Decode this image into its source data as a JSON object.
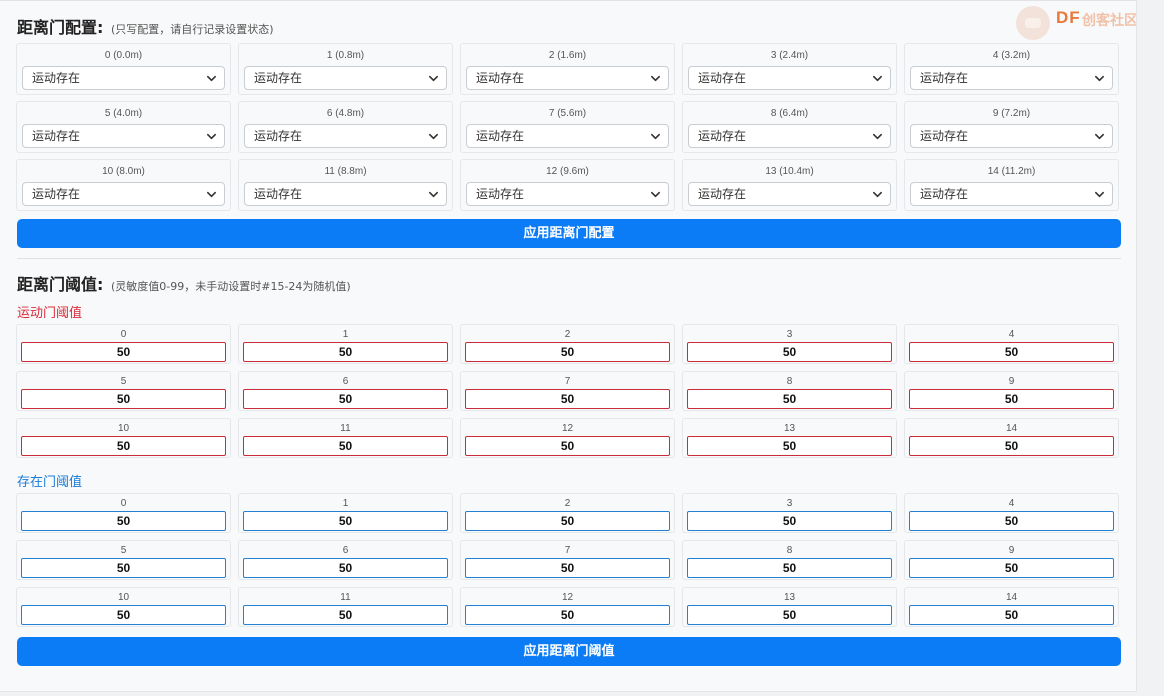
{
  "logo": {
    "brand": "DF",
    "text": "创客社区",
    "icon": "robot-logo-icon"
  },
  "gate_config": {
    "title": "距离门配置:",
    "hint": "(只写配置，请自行记录设置状态)",
    "gates": [
      {
        "label": "0 (0.0m)",
        "value": "运动存在"
      },
      {
        "label": "1 (0.8m)",
        "value": "运动存在"
      },
      {
        "label": "2 (1.6m)",
        "value": "运动存在"
      },
      {
        "label": "3 (2.4m)",
        "value": "运动存在"
      },
      {
        "label": "4 (3.2m)",
        "value": "运动存在"
      },
      {
        "label": "5 (4.0m)",
        "value": "运动存在"
      },
      {
        "label": "6 (4.8m)",
        "value": "运动存在"
      },
      {
        "label": "7 (5.6m)",
        "value": "运动存在"
      },
      {
        "label": "8 (6.4m)",
        "value": "运动存在"
      },
      {
        "label": "9 (7.2m)",
        "value": "运动存在"
      },
      {
        "label": "10 (8.0m)",
        "value": "运动存在"
      },
      {
        "label": "11 (8.8m)",
        "value": "运动存在"
      },
      {
        "label": "12 (9.6m)",
        "value": "运动存在"
      },
      {
        "label": "13 (10.4m)",
        "value": "运动存在"
      },
      {
        "label": "14 (11.2m)",
        "value": "运动存在"
      }
    ],
    "apply_label": "应用距离门配置"
  },
  "thresholds": {
    "title": "距离门阈值:",
    "hint": "(灵敏度值0-99，未手动设置时#15-24为随机值)",
    "motion": {
      "title": "运动门阈值",
      "color": "#d92c3a",
      "items": [
        {
          "label": "0",
          "value": "50"
        },
        {
          "label": "1",
          "value": "50"
        },
        {
          "label": "2",
          "value": "50"
        },
        {
          "label": "3",
          "value": "50"
        },
        {
          "label": "4",
          "value": "50"
        },
        {
          "label": "5",
          "value": "50"
        },
        {
          "label": "6",
          "value": "50"
        },
        {
          "label": "7",
          "value": "50"
        },
        {
          "label": "8",
          "value": "50"
        },
        {
          "label": "9",
          "value": "50"
        },
        {
          "label": "10",
          "value": "50"
        },
        {
          "label": "11",
          "value": "50"
        },
        {
          "label": "12",
          "value": "50"
        },
        {
          "label": "13",
          "value": "50"
        },
        {
          "label": "14",
          "value": "50"
        }
      ]
    },
    "still": {
      "title": "存在门阈值",
      "color": "#1a7bd8",
      "items": [
        {
          "label": "0",
          "value": "50"
        },
        {
          "label": "1",
          "value": "50"
        },
        {
          "label": "2",
          "value": "50"
        },
        {
          "label": "3",
          "value": "50"
        },
        {
          "label": "4",
          "value": "50"
        },
        {
          "label": "5",
          "value": "50"
        },
        {
          "label": "6",
          "value": "50"
        },
        {
          "label": "7",
          "value": "50"
        },
        {
          "label": "8",
          "value": "50"
        },
        {
          "label": "9",
          "value": "50"
        },
        {
          "label": "10",
          "value": "50"
        },
        {
          "label": "11",
          "value": "50"
        },
        {
          "label": "12",
          "value": "50"
        },
        {
          "label": "13",
          "value": "50"
        },
        {
          "label": "14",
          "value": "50"
        }
      ]
    },
    "apply_label": "应用距离门阈值"
  },
  "accent_color": "#0b7cf5"
}
